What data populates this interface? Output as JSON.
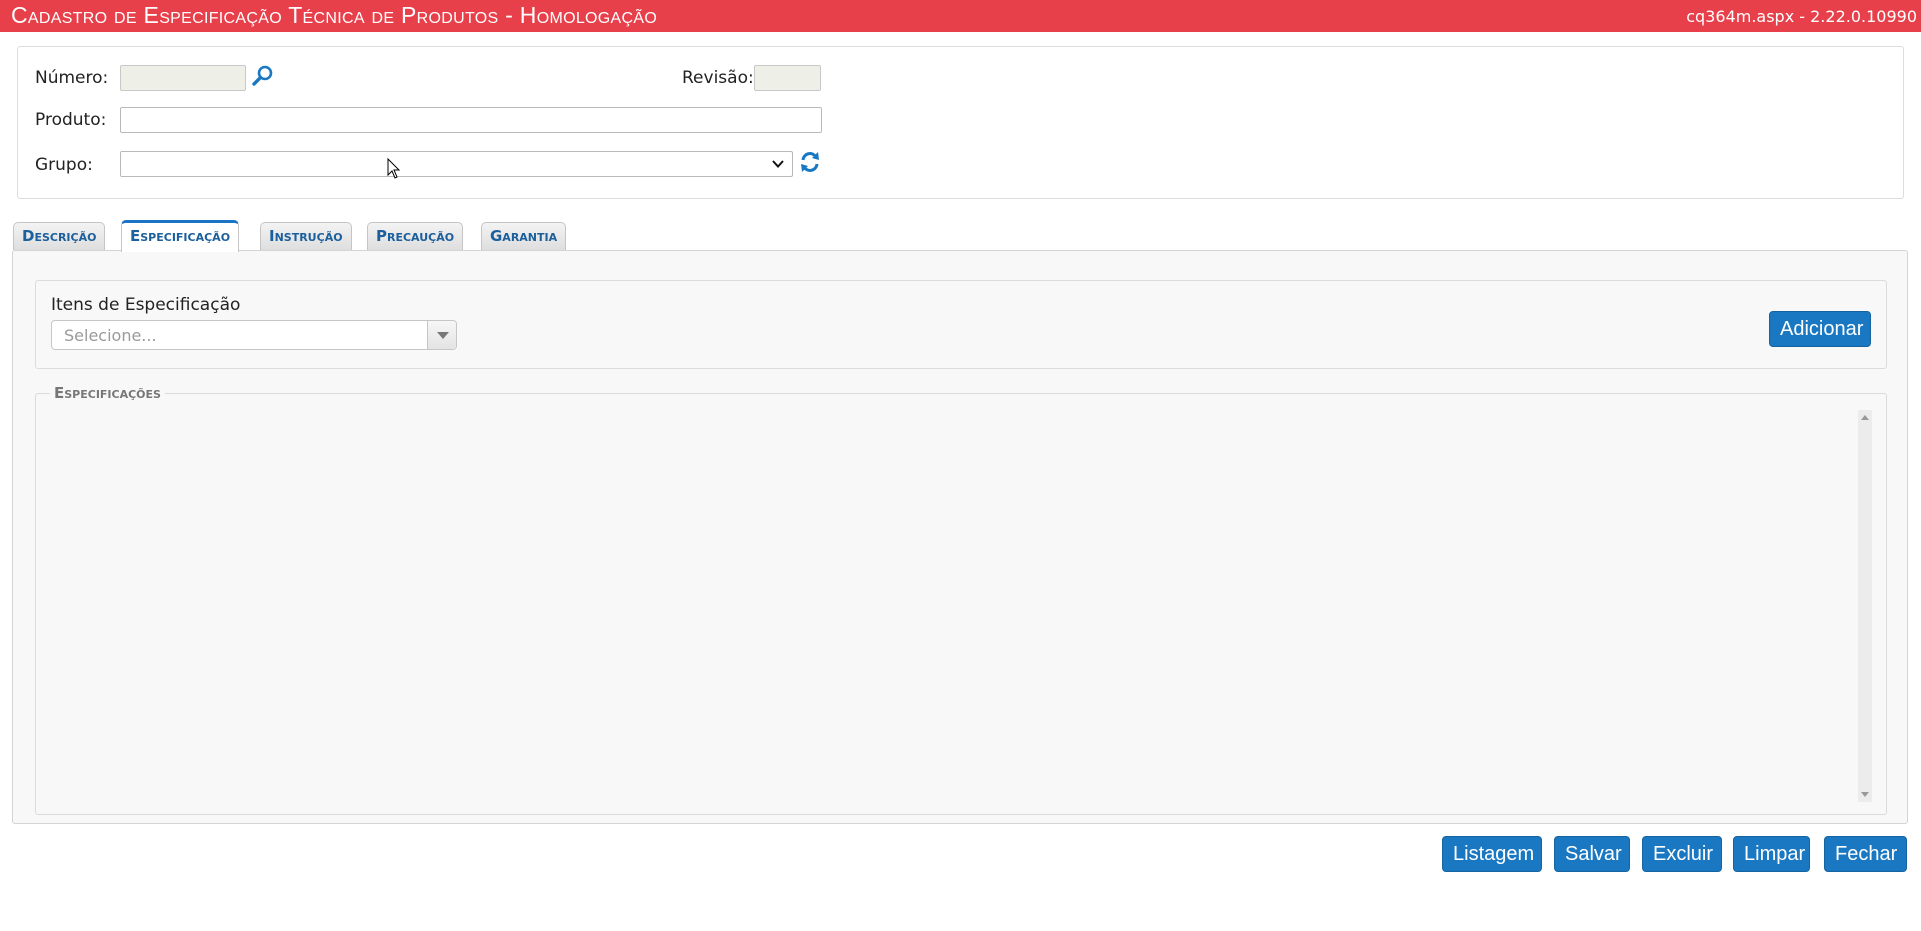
{
  "titlebar": {
    "title": "Cadastro de Especificação Técnica de Produtos  - Homologação",
    "version": "cq364m.aspx - 2.22.0.10990",
    "color": "#e8404b"
  },
  "form": {
    "numero_label": "Número:",
    "numero_value": "",
    "revisao_label": "Revisão:",
    "revisao_value": "",
    "produto_label": "Produto:",
    "produto_value": "",
    "grupo_label": "Grupo:",
    "grupo_value": "",
    "icons": {
      "search": "magnifier-icon",
      "refresh": "refresh-icon"
    }
  },
  "tabs": [
    {
      "label": "Descrição",
      "active": false
    },
    {
      "label": "Especificação",
      "active": true
    },
    {
      "label": "Instrução",
      "active": false
    },
    {
      "label": "Precaução",
      "active": false
    },
    {
      "label": "Garantia",
      "active": false
    }
  ],
  "items": {
    "label": "Itens de Especificação",
    "placeholder": "Selecione...",
    "add_button": "Adicionar"
  },
  "specs": {
    "legend": "Especificações"
  },
  "footer": {
    "listagem": "Listagem",
    "salvar": "Salvar",
    "excluir": "Excluir",
    "limpar": "Limpar",
    "fechar": "Fechar"
  },
  "colors": {
    "accent": "#1a78c2"
  }
}
